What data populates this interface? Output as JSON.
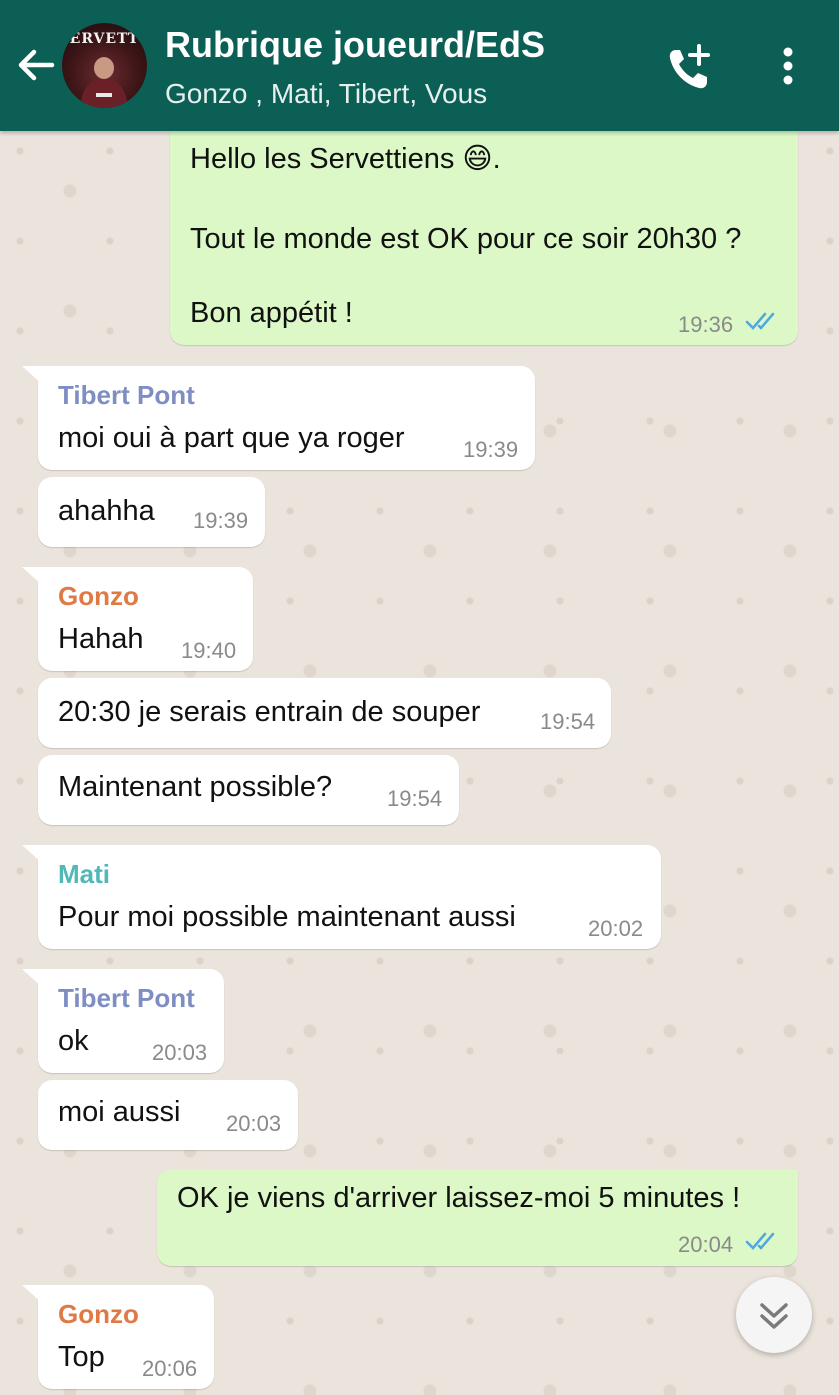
{
  "header": {
    "title": "Rubrique joueurd/EdS",
    "participants": "Gonzo , Mati, Tibert, Vous",
    "avatar_text": "ERVETT",
    "icons": {
      "back": "arrow-left-icon",
      "call": "add-call-icon",
      "menu": "more-vertical-icon"
    }
  },
  "colors": {
    "header_bg": "#0b5f55",
    "outgoing_bubble": "#dcf8c6",
    "incoming_bubble": "#ffffff",
    "tibert_name": "#7f8ec2",
    "gonzo_name": "#e07a45",
    "mati_name": "#52b7b9",
    "read_ticks": "#4fa7e0"
  },
  "messages": [
    {
      "direction": "out",
      "lines": [
        "Hello les Servettiens 😄.",
        "",
        "Tout le monde est OK pour ce soir 20h30 ?",
        "",
        "Bon appétit !"
      ],
      "time": "19:36",
      "status": "read"
    },
    {
      "direction": "in",
      "sender": "Tibert Pont",
      "text": "moi oui à part que ya roger",
      "time": "19:39"
    },
    {
      "direction": "in",
      "text": "ahahha",
      "time": "19:39"
    },
    {
      "direction": "in",
      "sender": "Gonzo",
      "text": "Hahah",
      "time": "19:40"
    },
    {
      "direction": "in",
      "text": "20:30 je serais entrain de souper",
      "time": "19:54"
    },
    {
      "direction": "in",
      "text": "Maintenant possible?",
      "time": "19:54"
    },
    {
      "direction": "in",
      "sender": "Mati",
      "text": "Pour moi possible maintenant aussi",
      "time": "20:02"
    },
    {
      "direction": "in",
      "sender": "Tibert Pont",
      "text": "ok",
      "time": "20:03"
    },
    {
      "direction": "in",
      "text": "moi aussi",
      "time": "20:03"
    },
    {
      "direction": "out",
      "text": "OK je viens d'arriver laissez-moi 5 minutes !",
      "time": "20:04",
      "status": "read"
    },
    {
      "direction": "in",
      "sender": "Gonzo",
      "text": "Top",
      "time": "20:06"
    }
  ],
  "scroll_button": {
    "icon": "double-chevron-down-icon"
  }
}
